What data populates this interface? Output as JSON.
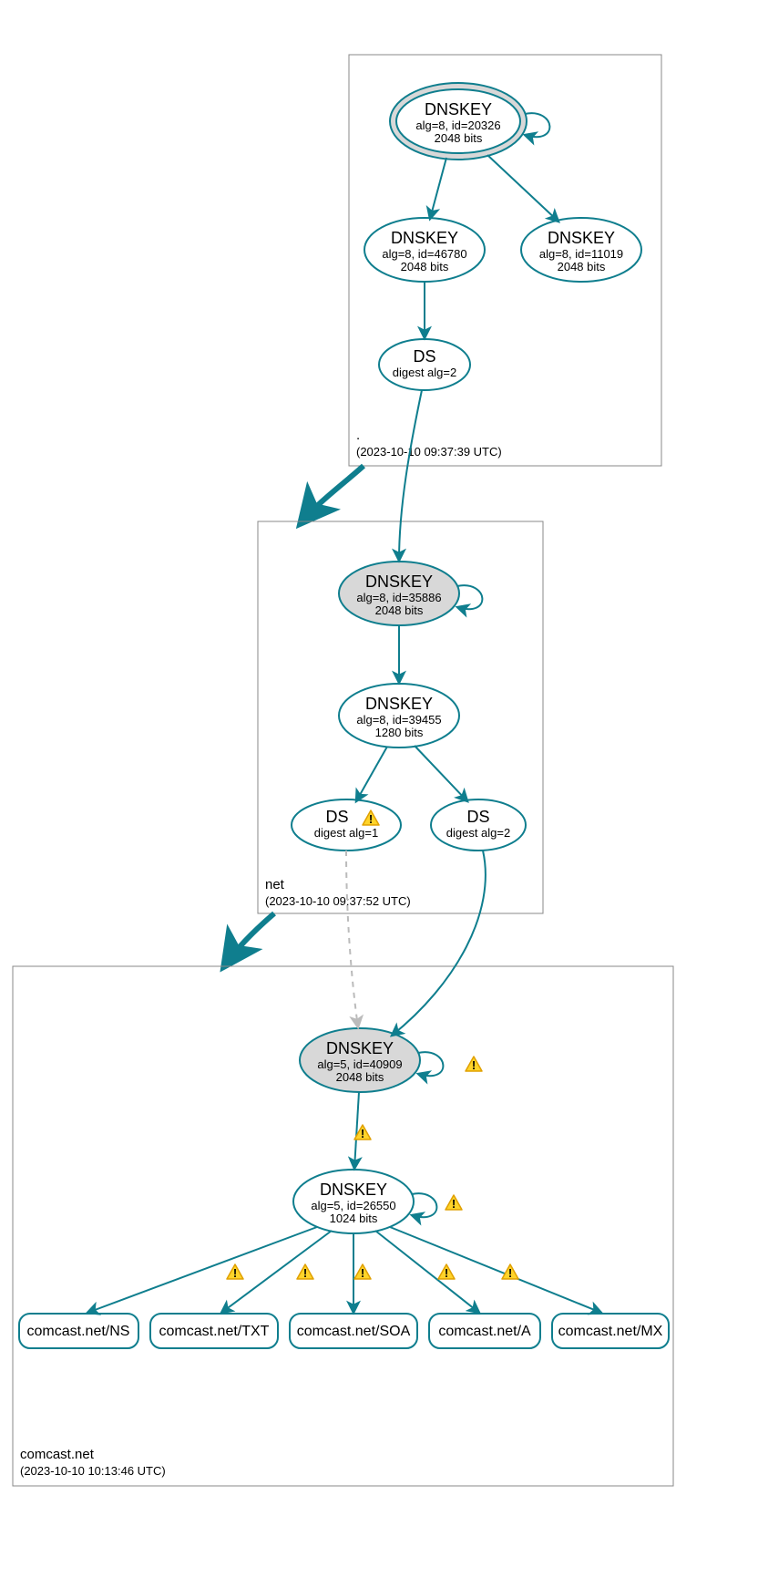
{
  "zones": {
    "root": {
      "name": ".",
      "timestamp": "(2023-10-10 09:37:39 UTC)"
    },
    "net": {
      "name": "net",
      "timestamp": "(2023-10-10 09:37:52 UTC)"
    },
    "leaf": {
      "name": "comcast.net",
      "timestamp": "(2023-10-10 10:13:46 UTC)"
    }
  },
  "nodes": {
    "root_ksk": {
      "title": "DNSKEY",
      "sub1": "alg=8, id=20326",
      "sub2": "2048 bits"
    },
    "root_zsk": {
      "title": "DNSKEY",
      "sub1": "alg=8, id=46780",
      "sub2": "2048 bits"
    },
    "root_key3": {
      "title": "DNSKEY",
      "sub1": "alg=8, id=11019",
      "sub2": "2048 bits"
    },
    "root_ds": {
      "title": "DS",
      "sub1": "digest alg=2"
    },
    "net_ksk": {
      "title": "DNSKEY",
      "sub1": "alg=8, id=35886",
      "sub2": "2048 bits"
    },
    "net_zsk": {
      "title": "DNSKEY",
      "sub1": "alg=8, id=39455",
      "sub2": "1280 bits"
    },
    "net_ds1": {
      "title": "DS",
      "sub1": "digest alg=1"
    },
    "net_ds2": {
      "title": "DS",
      "sub1": "digest alg=2"
    },
    "leaf_ksk": {
      "title": "DNSKEY",
      "sub1": "alg=5, id=40909",
      "sub2": "2048 bits"
    },
    "leaf_zsk": {
      "title": "DNSKEY",
      "sub1": "alg=5, id=26550",
      "sub2": "1024 bits"
    }
  },
  "rrsets": {
    "ns": "comcast.net/NS",
    "txt": "comcast.net/TXT",
    "soa": "comcast.net/SOA",
    "a": "comcast.net/A",
    "mx": "comcast.net/MX"
  }
}
